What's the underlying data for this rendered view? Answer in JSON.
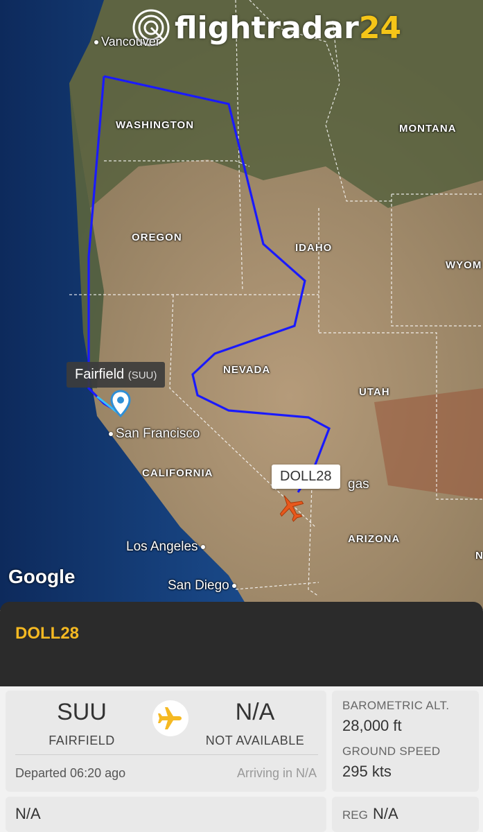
{
  "brand": {
    "name": "flightradar",
    "suffix": "24"
  },
  "map": {
    "states": [
      "WASHINGTON",
      "MONTANA",
      "OREGON",
      "IDAHO",
      "WYOM",
      "NEVADA",
      "UTAH",
      "CALIFORNIA",
      "ARIZONA",
      "N"
    ],
    "cities": [
      "Vancouver",
      "San Francisco",
      "Los Angeles",
      "San Diego",
      "gas"
    ],
    "attribution": "Google",
    "origin_tooltip": {
      "name": "Fairfield",
      "code": "(SUU)"
    },
    "flight_tooltip": "DOLL28",
    "colors": {
      "track": "#1a1aff",
      "aircraft": "#e8581c",
      "pin": "#2f8fd6"
    }
  },
  "panel": {
    "callsign": "DOLL28",
    "origin": {
      "code": "SUU",
      "name": "FAIRFIELD"
    },
    "destination": {
      "code": "N/A",
      "name": "NOT AVAILABLE"
    },
    "departed": "Departed 06:20 ago",
    "arriving": "Arriving in N/A",
    "altitude_label": "BAROMETRIC ALT.",
    "altitude_value": "28,000 ft",
    "speed_label": "GROUND SPEED",
    "speed_value": "295 kts",
    "aircraft_type": "N/A",
    "reg_label": "REG",
    "reg_value": "N/A",
    "accent_color": "#f5b922"
  }
}
